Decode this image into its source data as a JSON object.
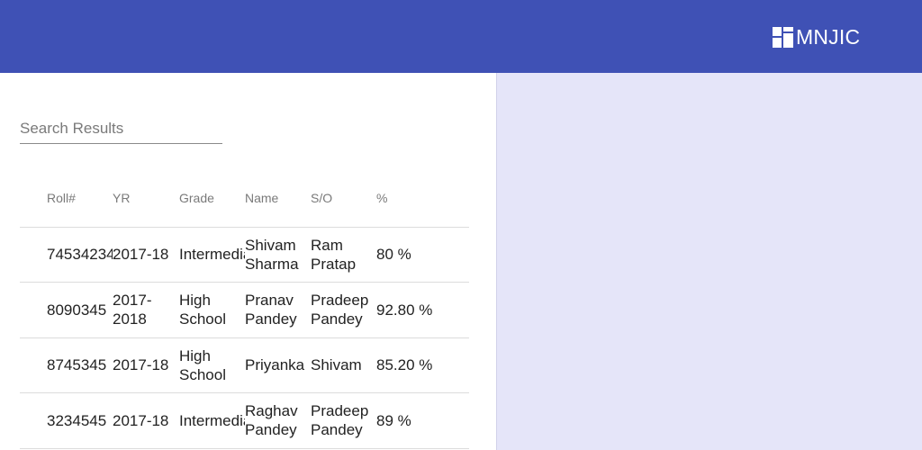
{
  "app": {
    "brand": "MNJIC",
    "colors": {
      "header": "#3f51b5",
      "right_panel": "#e5e5f9",
      "text": "#222222",
      "muted": "#7a7a7a"
    },
    "logo_icon": "windows-grid-logo-icon"
  },
  "search": {
    "placeholder": "Search Results",
    "value": ""
  },
  "table": {
    "headers": [
      "Roll#",
      "YR",
      "Grade",
      "Name",
      "S/O",
      "%"
    ],
    "rows": [
      {
        "roll": "74534234",
        "yr": "2017-18",
        "grade": "Intermediate",
        "name": "Shivam Sharma",
        "so": "Ram Pratap",
        "pct": "80 %"
      },
      {
        "roll": "8090345",
        "yr": "2017-2018",
        "grade": "High School",
        "name": "Pranav Pandey",
        "so": "Pradeep Pandey",
        "pct": "92.80 %"
      },
      {
        "roll": "8745345",
        "yr": "2017-18",
        "grade": "High School",
        "name": "Priyanka",
        "so": "Shivam",
        "pct": "85.20 %"
      },
      {
        "roll": "3234545",
        "yr": "2017-18",
        "grade": "Intermediate",
        "name": "Raghav Pandey",
        "so": "Pradeep Pandey",
        "pct": "89 %"
      }
    ]
  }
}
